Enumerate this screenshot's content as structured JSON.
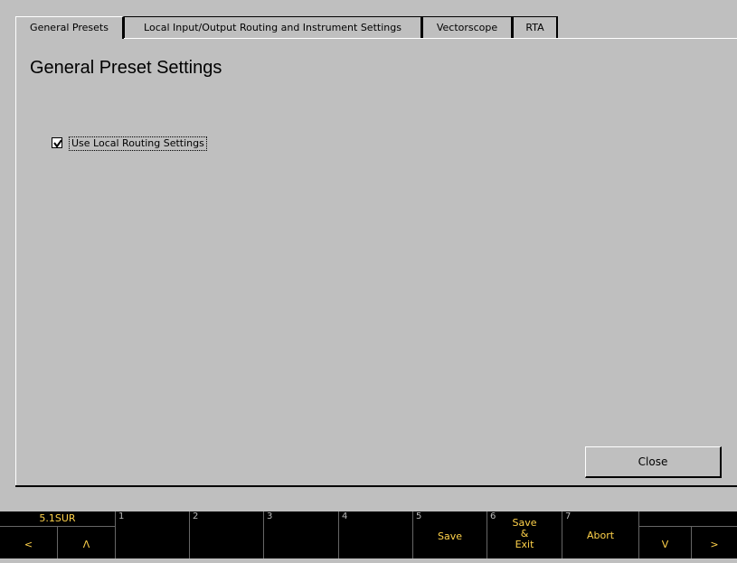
{
  "tabs": [
    {
      "label": "General Presets",
      "active": true
    },
    {
      "label": "Local Input/Output Routing and Instrument Settings",
      "active": false
    },
    {
      "label": "Vectorscope",
      "active": false
    },
    {
      "label": "RTA",
      "active": false
    }
  ],
  "main": {
    "title": "General Preset Settings",
    "use_local_routing": {
      "label": "Use Local Routing Settings",
      "checked": true
    },
    "close_label": "Close"
  },
  "softkeys": {
    "preset": {
      "label": "5.1SUR",
      "left_arrow": "<",
      "up_arrow": "Λ"
    },
    "keys": [
      {
        "num": "1",
        "label": ""
      },
      {
        "num": "2",
        "label": ""
      },
      {
        "num": "3",
        "label": ""
      },
      {
        "num": "4",
        "label": ""
      },
      {
        "num": "5",
        "label": "Save"
      },
      {
        "num": "6",
        "label_lines": [
          "Save",
          "&",
          "Exit"
        ]
      },
      {
        "num": "7",
        "label": "Abort"
      }
    ],
    "nav": {
      "down_arrow": "V",
      "right_arrow": ">"
    }
  },
  "colors": {
    "background": "#bfbfbf",
    "softkey_bg": "#000000",
    "softkey_text": "#ffd24a"
  }
}
